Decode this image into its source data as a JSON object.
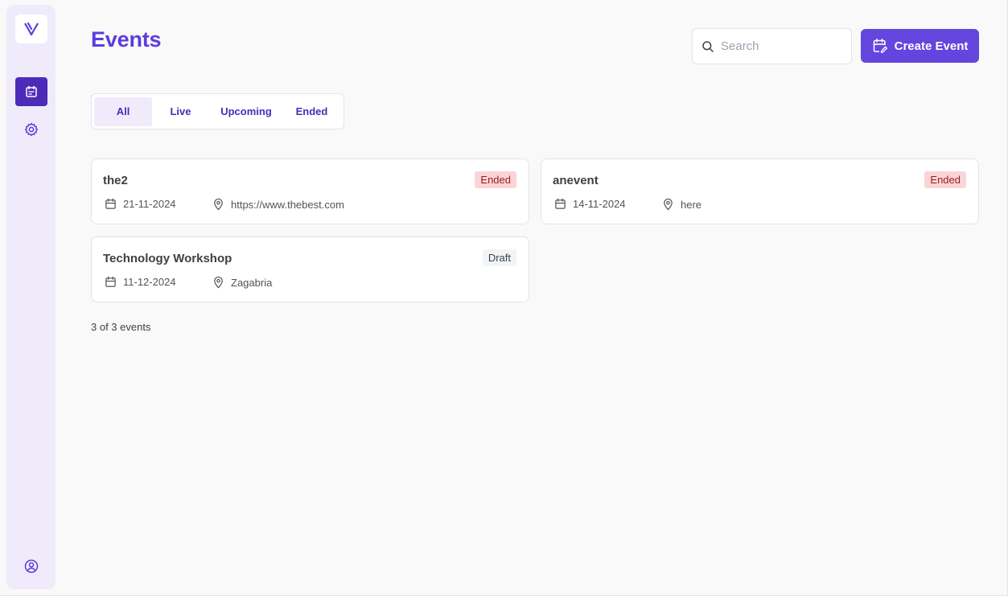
{
  "app": {
    "logo_letter": "V"
  },
  "header": {
    "title": "Events",
    "search_placeholder": "Search",
    "search_value": "",
    "create_label": "Create Event"
  },
  "tabs": [
    {
      "label": "All",
      "active": true
    },
    {
      "label": "Live",
      "active": false
    },
    {
      "label": "Upcoming",
      "active": false
    },
    {
      "label": "Ended",
      "active": false
    }
  ],
  "events": [
    {
      "title": "the2",
      "status": "Ended",
      "date": "21-11-2024",
      "location": "https://www.thebest.com"
    },
    {
      "title": "anevent",
      "status": "Ended",
      "date": "14-11-2024",
      "location": "here"
    },
    {
      "title": "Technology Workshop",
      "status": "Draft",
      "date": "11-12-2024",
      "location": "Zagabria"
    }
  ],
  "footer": {
    "count_text": "3 of 3 events"
  },
  "icons": {
    "logo": "v-logo-icon",
    "nav_events": "calendar-icon",
    "nav_settings": "gear-icon",
    "nav_profile": "user-circle-icon",
    "search": "search-icon",
    "create": "calendar-edit-icon",
    "date": "calendar-icon",
    "location": "map-pin-icon"
  },
  "colors": {
    "accent": "#6445de",
    "accent_dark": "#4c2bb8",
    "sidebar_bg": "#efebfb",
    "badge_ended_bg": "#fbd5d5",
    "badge_ended_text": "#9b1c1c",
    "badge_draft_bg": "#f3f4f6"
  }
}
